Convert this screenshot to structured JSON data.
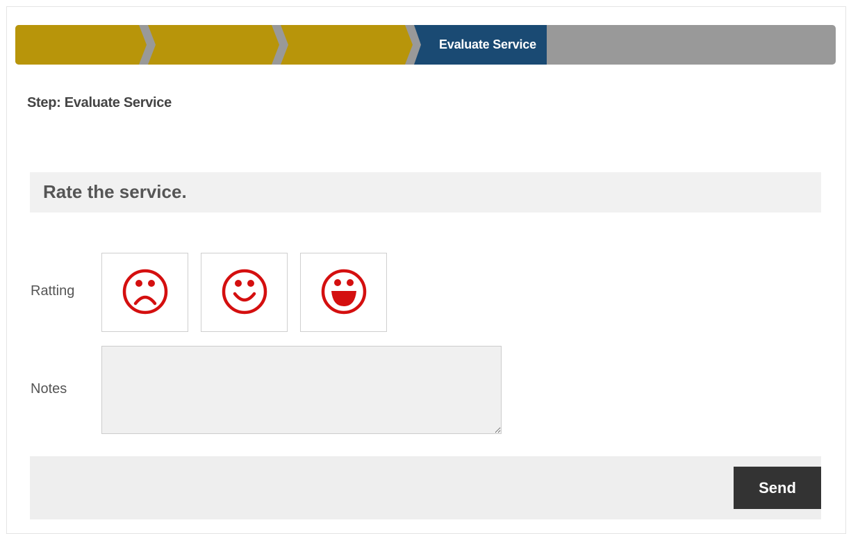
{
  "wizard": {
    "steps": [
      {
        "label": "",
        "state": "done"
      },
      {
        "label": "",
        "state": "done"
      },
      {
        "label": "",
        "state": "done"
      },
      {
        "label": "Evaluate Service",
        "state": "active"
      },
      {
        "label": "",
        "state": "pending"
      }
    ],
    "colors": {
      "done": "#b8950a",
      "active": "#1a4a73",
      "pending": "#999999"
    }
  },
  "step_title": "Step: Evaluate Service",
  "section": {
    "title": "Rate the service."
  },
  "form": {
    "rating_label": "Ratting",
    "rating_options": [
      {
        "icon": "sad-face-icon"
      },
      {
        "icon": "smile-face-icon"
      },
      {
        "icon": "laughing-face-icon"
      }
    ],
    "notes_label": "Notes",
    "notes_value": "",
    "icon_color": "#d40f0f"
  },
  "actions": {
    "send_label": "Send"
  }
}
